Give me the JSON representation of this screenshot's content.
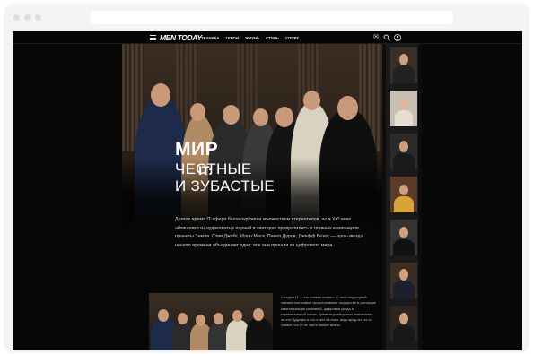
{
  "browser": {
    "url": ""
  },
  "nav": {
    "logo": "MEN TODAY",
    "links": [
      "ТЕХНИКА",
      "ГЕРОИ",
      "ЖИЗНЬ",
      "СТИЛЬ",
      "СПОРТ"
    ],
    "icons": [
      "menu-icon",
      "mail-icon",
      "search-icon",
      "user-icon"
    ]
  },
  "hero": {
    "title_line1": "МИР",
    "title_it": "IT:",
    "title_line2": "ЧЕСТНЫЕ\nИ ЗУБАСТЫЕ"
  },
  "article": {
    "intro": "Долгое время IT-сфера была окружена множеством стереотипов, но в XXI веке айтишники из чудаковатых парней в свитерах превратились в главных визионеров планеты Земля. Стив Джобс, Илон Маск, Павел Дуров, Джефф Безос — «рок-звезд» нашего времени объединяет одно: все они пришли из цифрового мира.",
    "side_text": "Сегодня IT — это «новая нефть». С этой индустрией связано все самые прогрессивные: лидерство и растущие капитализации компаний, цифровая среда и стремительный жизнь. Давайте разберемся, впечатляет ли это будущее и что стоит за этим, ведь вряд ли кто-то скажет, что IT не часть нашей жизни."
  },
  "colors": {
    "page_bg": "#070707",
    "text": "#ffffff"
  }
}
